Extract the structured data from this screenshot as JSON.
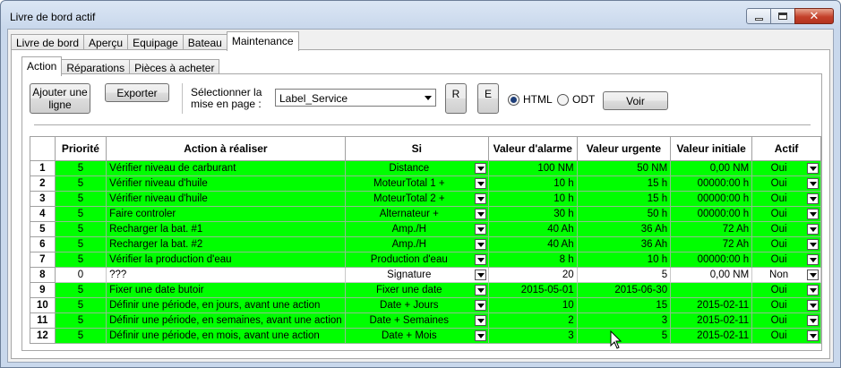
{
  "window": {
    "title": "Livre de bord actif"
  },
  "outer_tabs": [
    "Livre de bord",
    "Aperçu",
    "Equipage",
    "Bateau",
    "Maintenance"
  ],
  "inner_tabs": [
    "Action",
    "Réparations",
    "Pièces à acheter"
  ],
  "toolbar": {
    "add_line": "Ajouter une ligne",
    "export": "Exporter",
    "select_layout_label": "Sélectionner la mise en page :",
    "layout_value": "Label_Service",
    "r_button": "R",
    "e_button": "E",
    "html_label": "HTML",
    "odt_label": "ODT",
    "view_button": "Voir",
    "format_selected": "HTML"
  },
  "grid": {
    "columns": [
      "Priorité",
      "Action à réaliser",
      "Si",
      "Valeur d'alarme",
      "Valeur urgente",
      "Valeur initiale",
      "Actif"
    ],
    "rows": [
      {
        "n": "1",
        "p": "5",
        "action": "Vérifier niveau de carburant",
        "si": "Distance",
        "alarm": "100  NM",
        "urgent": "50  NM",
        "init": "0,00 NM",
        "actif": "Oui",
        "color": "green"
      },
      {
        "n": "2",
        "p": "5",
        "action": "Vérifier niveau d'huile",
        "si": "MoteurTotal 1 +",
        "alarm": "10  h",
        "urgent": "15  h",
        "init": "00000:00 h",
        "actif": "Oui",
        "color": "green"
      },
      {
        "n": "3",
        "p": "5",
        "action": "Vérifier niveau d'huile",
        "si": "MoteurTotal 2 +",
        "alarm": "10  h",
        "urgent": "15  h",
        "init": "00000:00 h",
        "actif": "Oui",
        "color": "green"
      },
      {
        "n": "4",
        "p": "5",
        "action": "Faire controler",
        "si": "Alternateur +",
        "alarm": "30  h",
        "urgent": "50  h",
        "init": "00000:00 h",
        "actif": "Oui",
        "color": "green"
      },
      {
        "n": "5",
        "p": "5",
        "action": "Recharger la bat. #1",
        "si": "Amp./H",
        "alarm": "40  Ah",
        "urgent": "36  Ah",
        "init": "72 Ah",
        "actif": "Oui",
        "color": "green"
      },
      {
        "n": "6",
        "p": "5",
        "action": "Recharger la bat. #2",
        "si": "Amp./H",
        "alarm": "40  Ah",
        "urgent": "36  Ah",
        "init": "72 Ah",
        "actif": "Oui",
        "color": "green"
      },
      {
        "n": "7",
        "p": "5",
        "action": "Vérifier la production d'eau",
        "si": "Production d'eau",
        "alarm": "8  h",
        "urgent": "10  h",
        "init": "00000:00 h",
        "actif": "Oui",
        "color": "green"
      },
      {
        "n": "8",
        "p": "0",
        "action": "???",
        "si": "Signature",
        "alarm": "20",
        "urgent": "5",
        "init": "0,00 NM",
        "actif": "Non",
        "color": "white"
      },
      {
        "n": "9",
        "p": "5",
        "action": "Fixer une date butoir",
        "si": "Fixer une date",
        "alarm": "2015-05-01",
        "urgent": "2015-06-30",
        "init": "",
        "actif": "Oui",
        "color": "green"
      },
      {
        "n": "10",
        "p": "5",
        "action": "Définir une période, en jours, avant une action",
        "si": "Date + Jours",
        "alarm": "10",
        "urgent": "15",
        "init": "2015-02-11",
        "actif": "Oui",
        "color": "green"
      },
      {
        "n": "11",
        "p": "5",
        "action": "Définir une période, en semaines, avant une action",
        "si": "Date + Semaines",
        "alarm": "2",
        "urgent": "3",
        "init": "2015-02-11",
        "actif": "Oui",
        "color": "green"
      },
      {
        "n": "12",
        "p": "5",
        "action": "Définir une période, en mois, avant une action",
        "si": "Date + Mois",
        "alarm": "3",
        "urgent": "5",
        "init": "2015-02-11",
        "actif": "Oui",
        "color": "green"
      }
    ]
  },
  "colors": {
    "row_green": "#00ff00",
    "row_white": "#ffffff"
  }
}
